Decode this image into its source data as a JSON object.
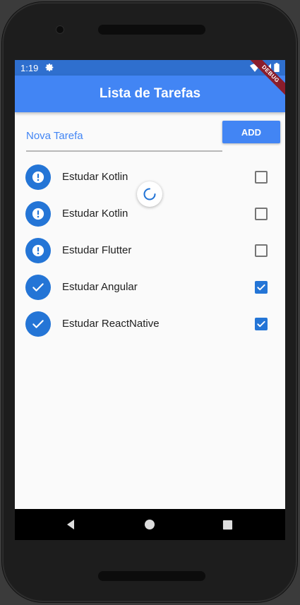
{
  "status_bar": {
    "time": "1:19"
  },
  "app_bar": {
    "title": "Lista de Tarefas"
  },
  "debug_banner": "DEBUG",
  "new_task": {
    "placeholder": "Nova Tarefa",
    "value": ""
  },
  "add_button": {
    "label": "ADD"
  },
  "tasks": [
    {
      "label": "Estudar Kotlin",
      "done": false,
      "icon": "exclamation-icon"
    },
    {
      "label": "Estudar Kotlin",
      "done": false,
      "icon": "exclamation-icon"
    },
    {
      "label": "Estudar Flutter",
      "done": false,
      "icon": "exclamation-icon"
    },
    {
      "label": "Estudar Angular",
      "done": true,
      "icon": "check-icon"
    },
    {
      "label": "Estudar ReactNative",
      "done": true,
      "icon": "check-icon"
    }
  ],
  "colors": {
    "app_bar": "#4285f4",
    "status_bar": "#2f6fce",
    "accent": "#2475d6",
    "debug_banner": "#8a1d2c"
  },
  "nav_bar": {
    "icons": [
      "back-icon",
      "home-icon",
      "recents-icon"
    ]
  }
}
